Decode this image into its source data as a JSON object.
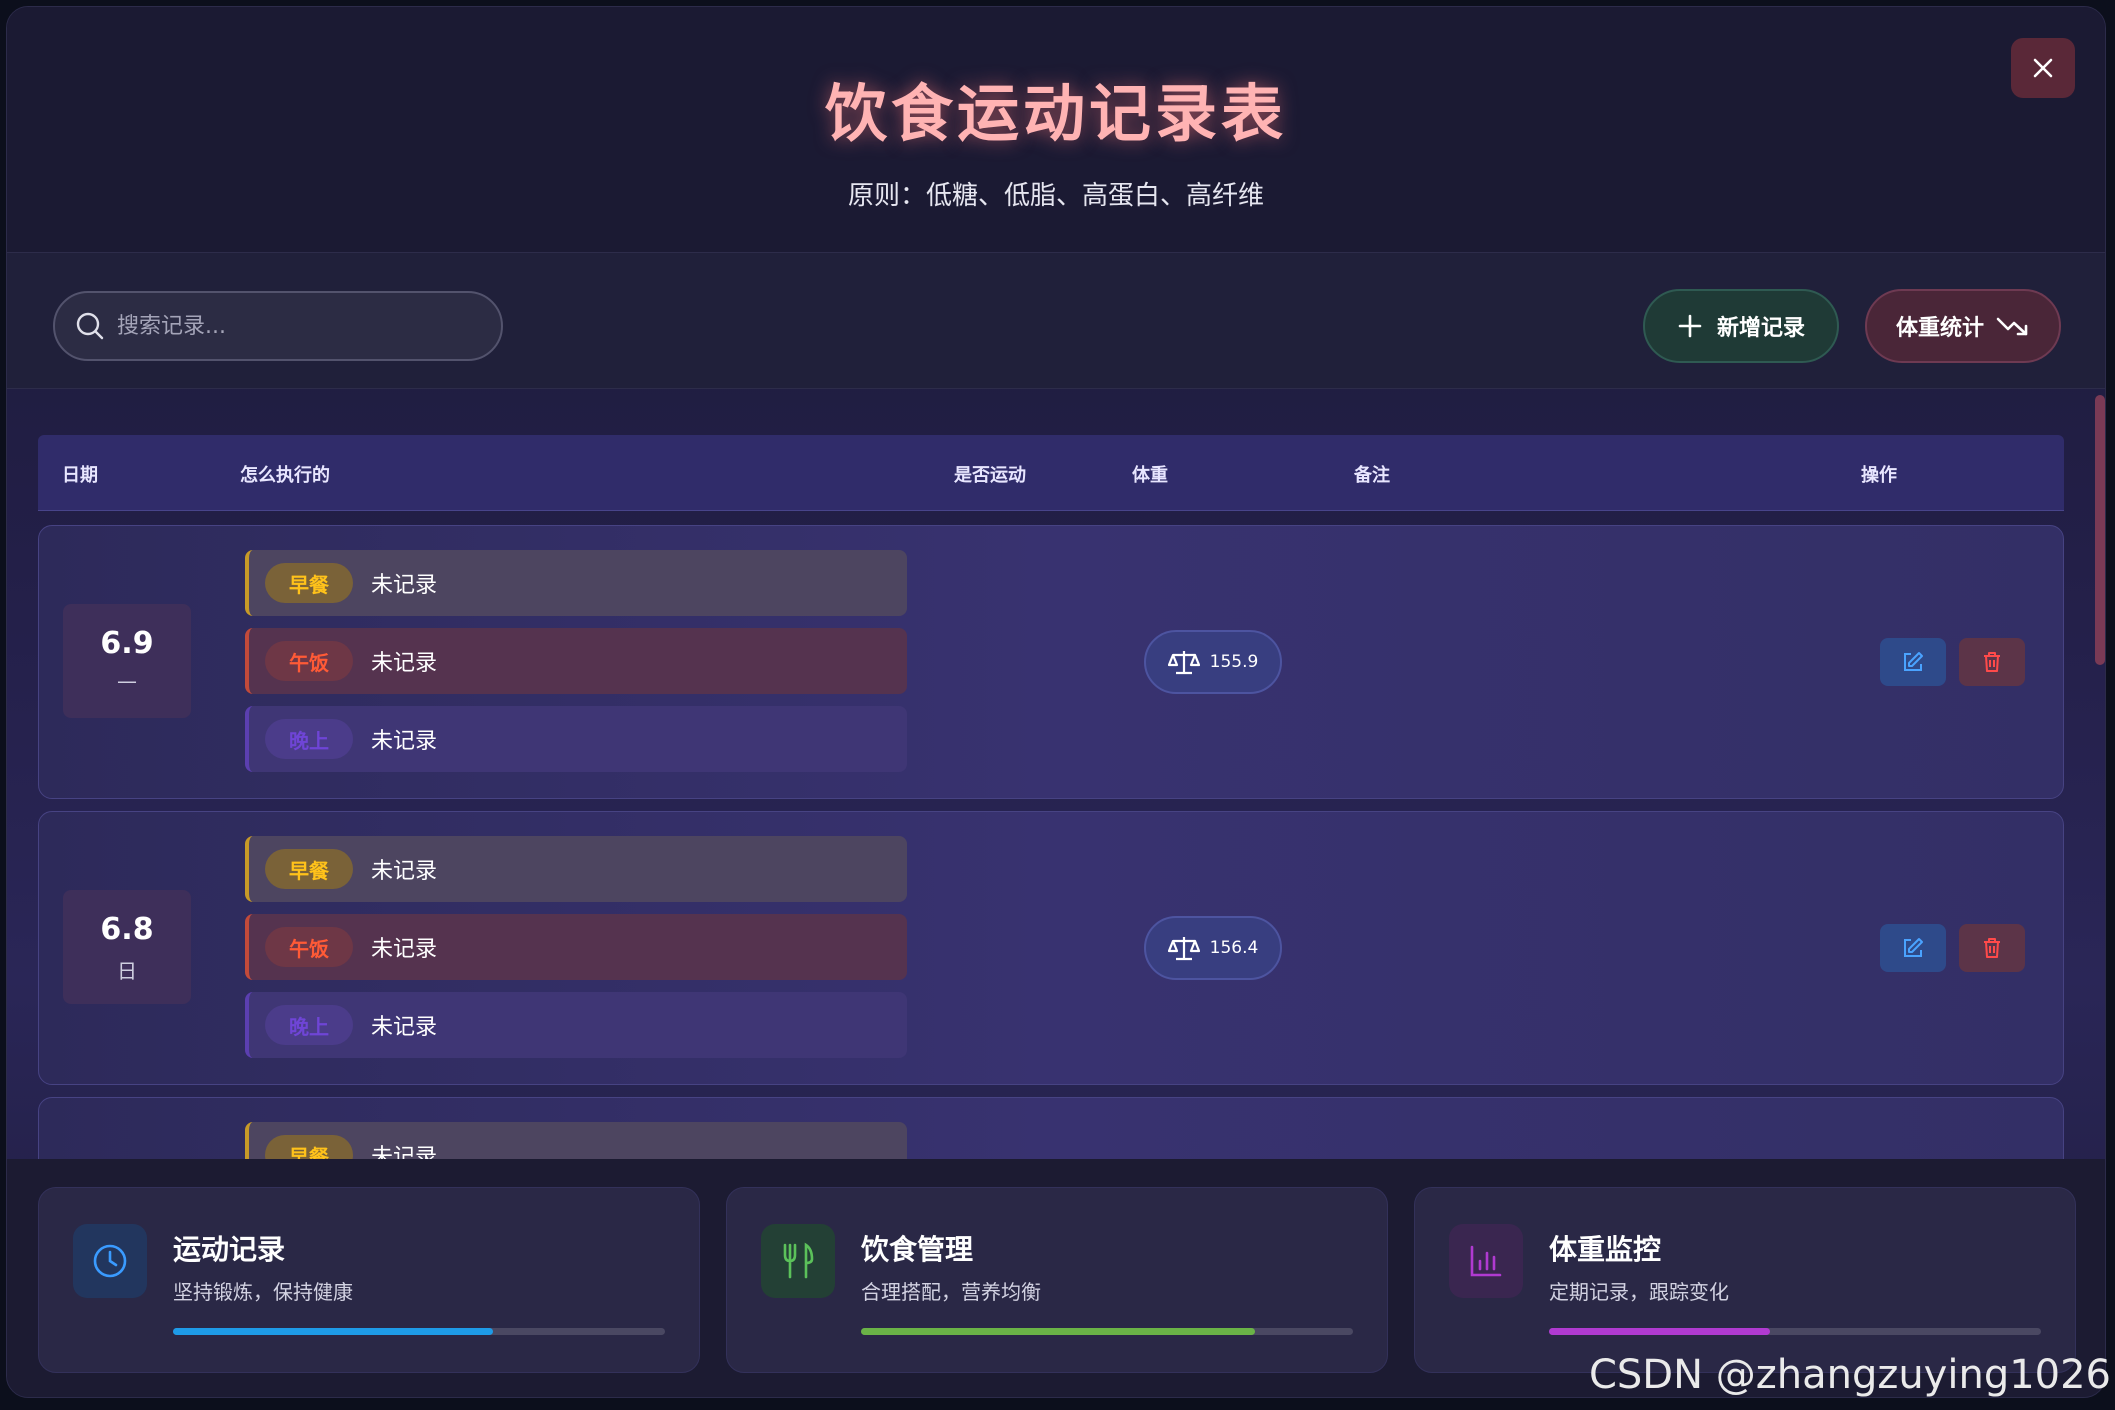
{
  "header": {
    "title": "饮食运动记录表",
    "subtitle": "原则：低糖、低脂、高蛋白、高纤维"
  },
  "toolbar": {
    "search_placeholder": "搜索记录...",
    "add_label": "新增记录",
    "stats_label": "体重统计"
  },
  "table": {
    "columns": [
      "日期",
      "怎么执行的",
      "是否运动",
      "体重",
      "备注",
      "操作"
    ],
    "rows": [
      {
        "date": "6.9",
        "day": "—",
        "meals": [
          {
            "tag": "早餐",
            "text": "未记录"
          },
          {
            "tag": "午饭",
            "text": "未记录"
          },
          {
            "tag": "晚上",
            "text": "未记录"
          }
        ],
        "weight": "155.9"
      },
      {
        "date": "6.8",
        "day": "日",
        "meals": [
          {
            "tag": "早餐",
            "text": "未记录"
          },
          {
            "tag": "午饭",
            "text": "未记录"
          },
          {
            "tag": "晚上",
            "text": "未记录"
          }
        ],
        "weight": "156.4"
      },
      {
        "date": "",
        "day": "",
        "meals": [
          {
            "tag": "早餐",
            "text": "未记录"
          }
        ],
        "weight": ""
      }
    ]
  },
  "cards": [
    {
      "title": "运动记录",
      "subtitle": "坚持锻炼，保持健康",
      "progress": 0.65,
      "color": "#1e9be8",
      "icon": "clock-icon"
    },
    {
      "title": "饮食管理",
      "subtitle": "合理搭配，营养均衡",
      "progress": 0.8,
      "color": "#6ab347",
      "icon": "utensils-icon"
    },
    {
      "title": "体重监控",
      "subtitle": "定期记录，跟踪变化",
      "progress": 0.45,
      "color": "#b03ad1",
      "icon": "bar-chart-icon"
    }
  ],
  "colors": {
    "accent_title": "#ffb3b3",
    "breakfast": "#ffc21a",
    "lunch": "#ff5a36",
    "dinner": "#6f45d6"
  },
  "watermark": "CSDN @zhangzuying1026"
}
